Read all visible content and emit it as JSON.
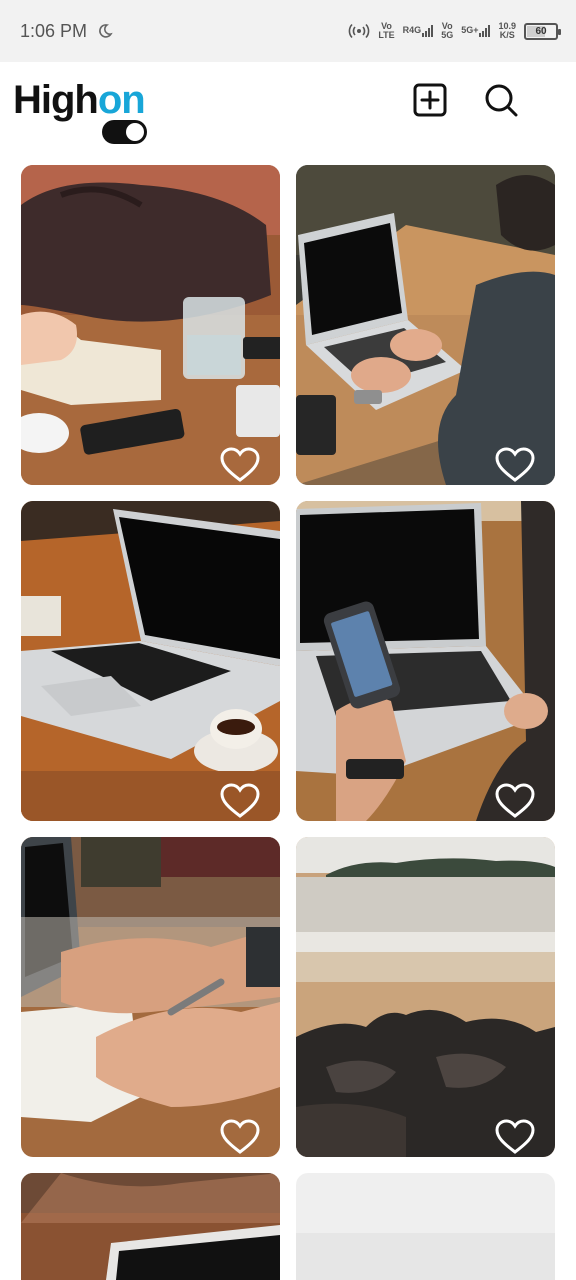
{
  "status_bar": {
    "time": "1:06 PM",
    "moon_icon": "moon-icon",
    "hotspot_icon": "hotspot-icon",
    "sim1_top": "Vo",
    "sim1_bottom": "LTE",
    "sim1_signal": "R4G",
    "sim2_top": "Vo",
    "sim2_bottom": "5G",
    "sim2_signal": "5G+",
    "speed_value": "10.9",
    "speed_unit": "K/S",
    "battery": "60"
  },
  "header": {
    "logo_part1": "High",
    "logo_part2": "on",
    "logo_accent": "#18a6d8",
    "add_icon": "add-square-icon",
    "search_icon": "search-icon",
    "dark_mode_toggle": "on"
  },
  "feed": {
    "posts": [
      {
        "subject": "desk with bag, notebook, glass of water and phones",
        "liked": false
      },
      {
        "subject": "person typing on laptop",
        "liked": false
      },
      {
        "subject": "laptop on wooden table with coffee cup",
        "liked": false
      },
      {
        "subject": "hand holding smartphone over laptop",
        "liked": false
      },
      {
        "subject": "hand writing in notebook",
        "liked": false
      },
      {
        "subject": "rocky beach shoreline",
        "liked": false
      },
      {
        "subject": "laptop on table (partial)",
        "liked": false
      },
      {
        "subject": "light image (partial)",
        "liked": false
      }
    ]
  }
}
